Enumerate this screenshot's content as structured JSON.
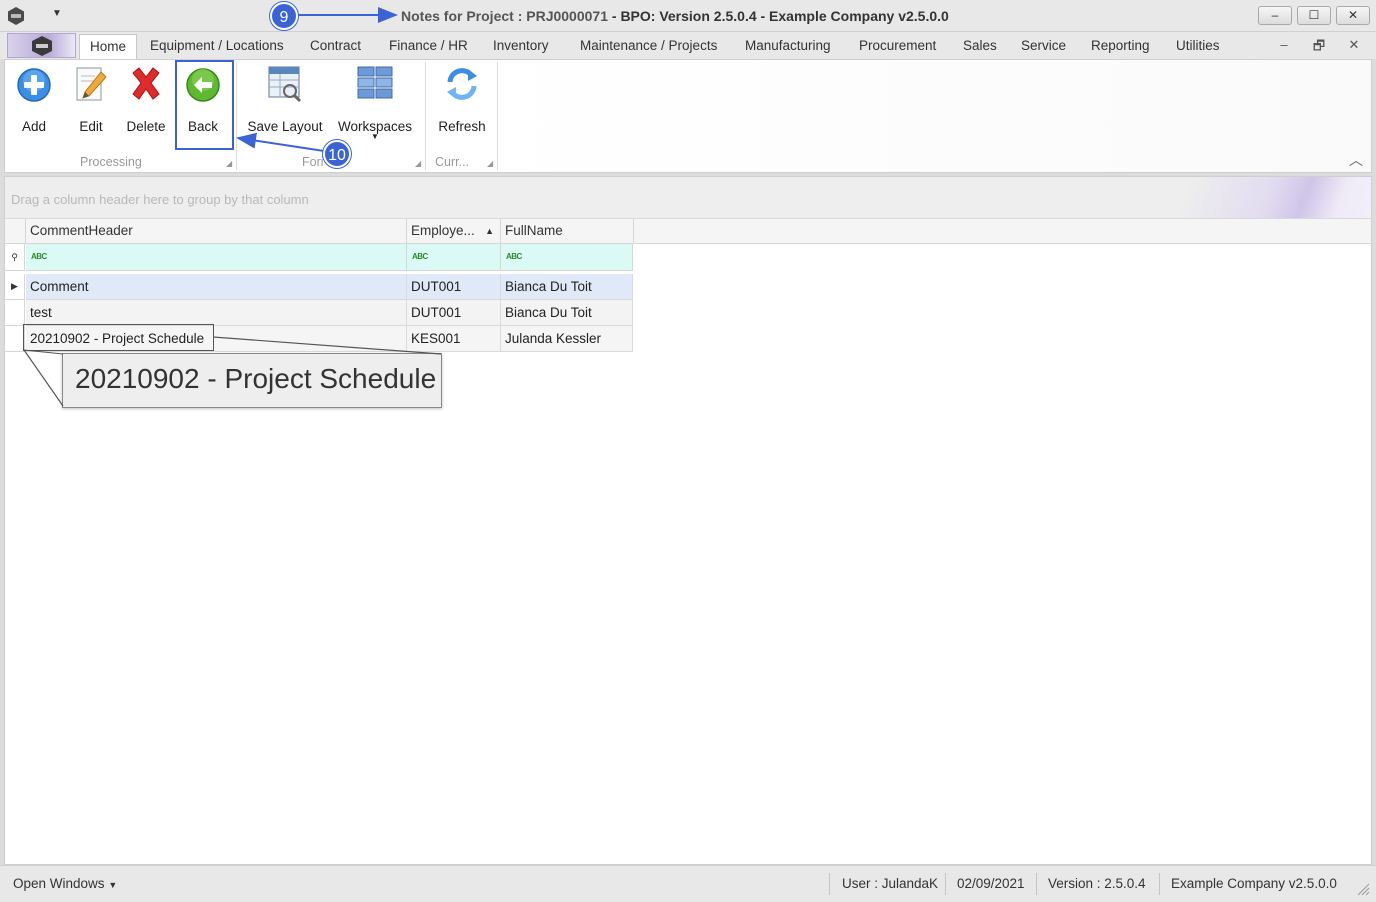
{
  "window": {
    "title_prefix": "Notes for Project : ",
    "title_project": "PRJ0000071",
    "title_suffix": " - BPO: Version 2.5.0.4 - Example Company v2.5.0.0",
    "minimize_label": "–",
    "maximize_label": "☐",
    "close_label": "✕"
  },
  "tabs": [
    {
      "label": "Home",
      "active": true
    },
    {
      "label": "Equipment / Locations"
    },
    {
      "label": "Contract"
    },
    {
      "label": "Finance / HR"
    },
    {
      "label": "Inventory"
    },
    {
      "label": "Maintenance / Projects"
    },
    {
      "label": "Manufacturing"
    },
    {
      "label": "Procurement"
    },
    {
      "label": "Sales"
    },
    {
      "label": "Service"
    },
    {
      "label": "Reporting"
    },
    {
      "label": "Utilities"
    }
  ],
  "mdi_controls": {
    "minimize": "–",
    "restore": "🗗",
    "close": "✕"
  },
  "ribbon": {
    "buttons": {
      "add": "Add",
      "edit": "Edit",
      "delete": "Delete",
      "back": "Back",
      "save_layout": "Save Layout",
      "workspaces": "Workspaces",
      "refresh": "Refresh"
    },
    "groups": {
      "processing": "Processing",
      "format": "Fori",
      "current": "Curr..."
    },
    "icons": {
      "add": "add-circle-icon",
      "edit": "pencil-icon",
      "delete": "red-x-icon",
      "back": "green-back-arrow-icon",
      "save_layout": "save-layout-icon",
      "workspaces": "workspaces-grid-icon",
      "refresh": "refresh-icon"
    },
    "colors": {
      "highlight": "#3b63d6",
      "back_green": "#5fb832",
      "delete_red": "#e02b2b",
      "add_blue": "#3a8ee6"
    }
  },
  "annotations": {
    "badge_title": "9",
    "badge_back": "10"
  },
  "grid": {
    "group_panel_hint": "Drag a column header here to group by that column",
    "columns": [
      {
        "label": "CommentHeader"
      },
      {
        "label": "Employe..."
      },
      {
        "label": "FullName"
      }
    ],
    "filter_placeholder": "ABC",
    "rows": [
      {
        "comment_header": "Comment",
        "employee": "DUT001",
        "full_name": "Bianca Du Toit"
      },
      {
        "comment_header": "test",
        "employee": "DUT001",
        "full_name": "Bianca Du Toit"
      },
      {
        "comment_header": "20210902 - Project Schedule",
        "employee": "KES001",
        "full_name": "Julanda Kessler"
      }
    ],
    "zoom_callout_text": "20210902 - Project Schedule"
  },
  "statusbar": {
    "open_windows": "Open Windows",
    "user": "User : JulandaK",
    "date": "02/09/2021",
    "version": "Version : 2.5.0.4",
    "company": "Example Company v2.5.0.0"
  }
}
